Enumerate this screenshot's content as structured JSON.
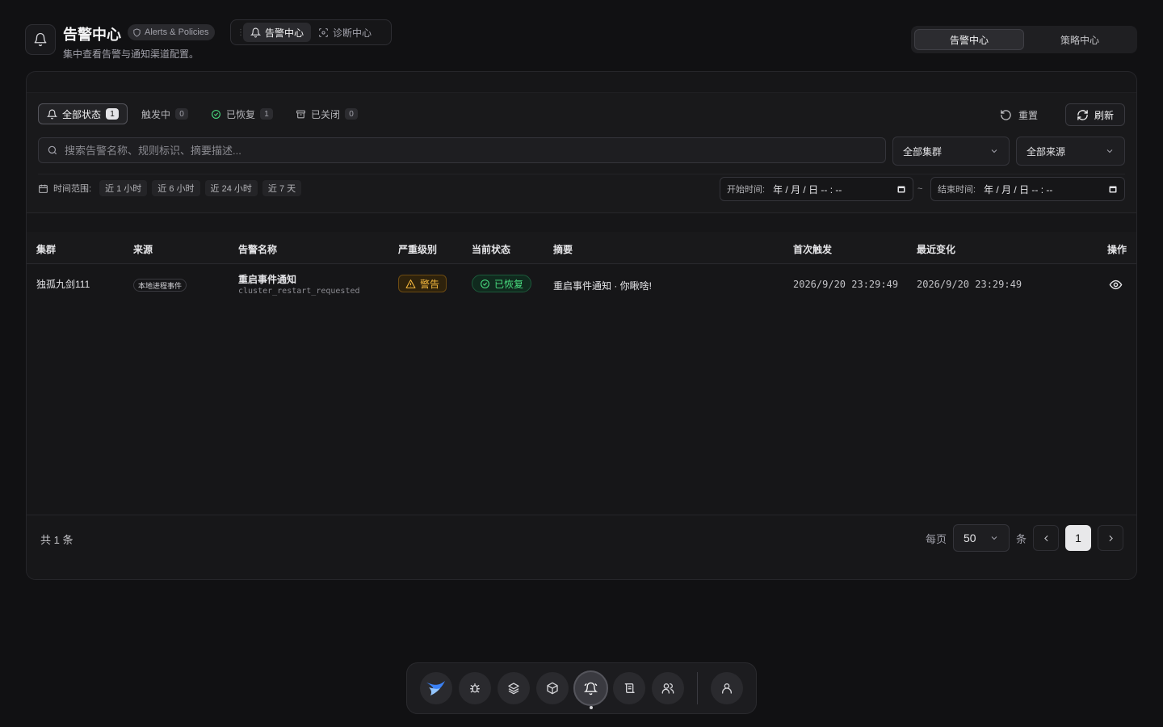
{
  "header": {
    "title": "告警中心",
    "badge": "Alerts & Policies",
    "subtitle": "集中查看告警与通知渠道配置。",
    "mode_tabs": [
      {
        "label": "告警中心",
        "active": true
      },
      {
        "label": "诊断中心",
        "active": false
      }
    ],
    "view_tabs": [
      {
        "label": "告警中心",
        "active": true
      },
      {
        "label": "策略中心",
        "active": false
      }
    ]
  },
  "filters": {
    "status_tabs": [
      {
        "label": "全部状态",
        "count": "1",
        "active": true,
        "icon": "bell-icon"
      },
      {
        "label": "触发中",
        "count": "0",
        "active": false,
        "icon": ""
      },
      {
        "label": "已恢复",
        "count": "1",
        "active": false,
        "icon": "check-circle-icon"
      },
      {
        "label": "已关闭",
        "count": "0",
        "active": false,
        "icon": "archive-icon"
      }
    ],
    "reset_label": "重置",
    "refresh_label": "刷新",
    "search_placeholder": "搜索告警名称、规则标识、摘要描述...",
    "cluster_select": "全部集群",
    "source_select": "全部来源",
    "range_label": "时间范围:",
    "range_chips": [
      "近 1 小时",
      "近 6 小时",
      "近 24 小时",
      "近 7 天"
    ],
    "start_label": "开始时间:",
    "start_value": "年 / 月 / 日  -- : --",
    "end_label": "结束时间:",
    "end_value": "年 / 月 / 日  -- : --",
    "tilde": "~"
  },
  "table": {
    "columns": [
      "集群",
      "来源",
      "告警名称",
      "严重级别",
      "当前状态",
      "摘要",
      "首次触发",
      "最近变化",
      "操作"
    ],
    "rows": [
      {
        "cluster": "独孤九剑111",
        "source": "本地进程事件",
        "name": "重启事件通知",
        "rule": "cluster_restart_requested",
        "severity": "警告",
        "status": "已恢复",
        "summary": "重启事件通知 · 你瞅啥!",
        "first": "2026/9/20 23:29:49",
        "last": "2026/9/20 23:29:49"
      }
    ]
  },
  "footer": {
    "total": "共 1 条",
    "per_page_label": "每页",
    "per_page_value": "50",
    "unit": "条",
    "current_page": "1"
  },
  "colors": {
    "background": "#111113",
    "panel": "#161618",
    "warning": "#f5b83d",
    "success": "#4ade80"
  },
  "dock": {
    "items": [
      "logo-icon",
      "bug-icon",
      "layers-icon",
      "package-icon",
      "bell-icon",
      "scroll-icon",
      "users-icon",
      "user-icon"
    ],
    "active": "bell-icon"
  }
}
